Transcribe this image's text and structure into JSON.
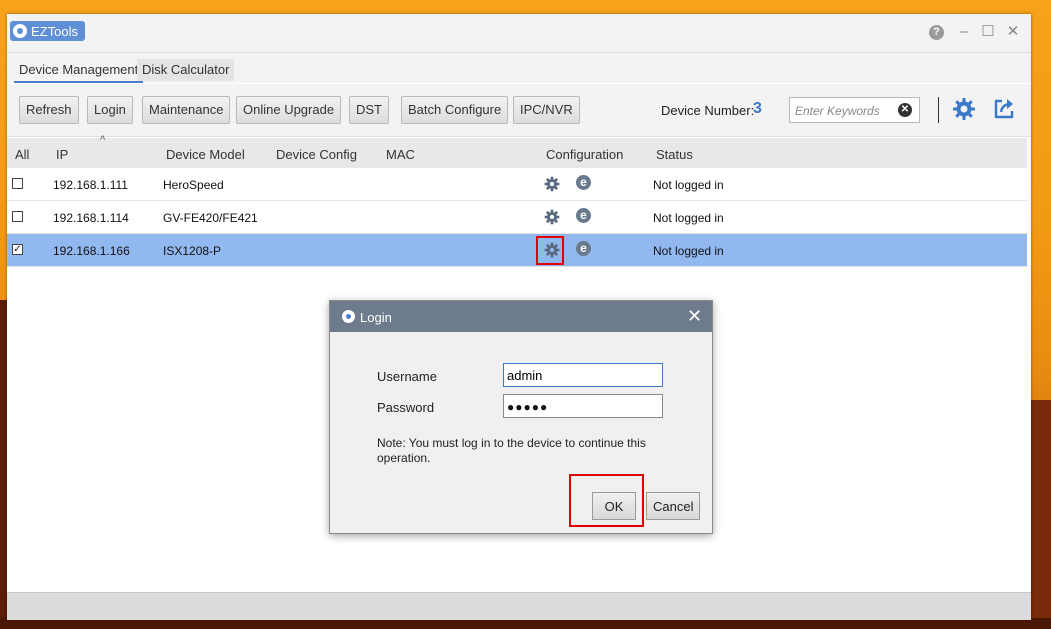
{
  "window": {
    "app_title": "EZTools",
    "help": "?",
    "minimize": "–",
    "maximize": "☐",
    "close": "✕"
  },
  "tabs": [
    {
      "label": "Device Management",
      "active": true
    },
    {
      "label": "Disk Calculator",
      "active": false
    }
  ],
  "toolbar": {
    "buttons": [
      "Refresh",
      "Login",
      "Maintenance",
      "Online Upgrade",
      "DST",
      "Batch Configure",
      "IPC/NVR"
    ],
    "device_number_label": "Device Number:",
    "device_number_value": "3",
    "search_placeholder": "Enter Keywords",
    "clear": "✕",
    "settings_icon": "gear-icon",
    "export_icon": "export-icon"
  },
  "table": {
    "columns": [
      "All",
      "IP",
      "Device Model",
      "Device Config",
      "MAC",
      "Configuration",
      "Status"
    ],
    "sort_indicator": "^",
    "rows": [
      {
        "checked": false,
        "ip": "192.168.1.111",
        "model": "HeroSpeed",
        "config": "",
        "mac": "",
        "status": "Not logged in"
      },
      {
        "checked": false,
        "ip": "192.168.1.114",
        "model": "GV-FE420/FE421",
        "config": "",
        "mac": "",
        "status": "Not logged in"
      },
      {
        "checked": true,
        "ip": "192.168.1.166",
        "model": "ISX1208-P",
        "config": "",
        "mac": "",
        "status": "Not logged in"
      }
    ],
    "check_mark": "✓",
    "ie_glyph": "e"
  },
  "login_dialog": {
    "title": "Login",
    "close": "✕",
    "username_label": "Username",
    "username_value": "admin",
    "password_label": "Password",
    "password_mask": "●●●●●",
    "note": "Note: You must log in to the device to continue this operation.",
    "ok_label": "OK",
    "cancel_label": "Cancel"
  },
  "colors": {
    "accent": "#4a7fd0",
    "selected_row": "#92b8f0",
    "dialog_title": "#6e7b8c",
    "highlight": "#e00000"
  }
}
